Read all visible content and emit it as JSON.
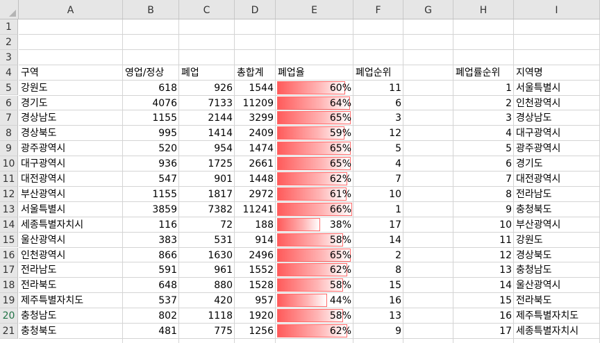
{
  "columns": [
    "A",
    "B",
    "C",
    "D",
    "E",
    "F",
    "G",
    "H",
    "I"
  ],
  "rows": [
    "1",
    "2",
    "3",
    "4",
    "5",
    "6",
    "7",
    "8",
    "9",
    "10",
    "11",
    "12",
    "13",
    "14",
    "15",
    "16",
    "17",
    "18",
    "19",
    "20",
    "21"
  ],
  "headers": {
    "A": "구역",
    "B": "영업/정상",
    "C": "폐업",
    "D": "총합계",
    "E": "폐업율",
    "F": "폐업순위",
    "H": "폐업률순위",
    "I": "지역명"
  },
  "table": [
    {
      "A": "강원도",
      "B": "618",
      "C": "926",
      "D": "1544",
      "E": "60%",
      "pct": 60,
      "F": "11",
      "H": "1",
      "I": "서울특별시"
    },
    {
      "A": "경기도",
      "B": "4076",
      "C": "7133",
      "D": "11209",
      "E": "64%",
      "pct": 64,
      "F": "6",
      "H": "2",
      "I": "인천광역시"
    },
    {
      "A": "경상남도",
      "B": "1155",
      "C": "2144",
      "D": "3299",
      "E": "65%",
      "pct": 65,
      "F": "3",
      "H": "3",
      "I": "경상남도"
    },
    {
      "A": "경상북도",
      "B": "995",
      "C": "1414",
      "D": "2409",
      "E": "59%",
      "pct": 59,
      "F": "12",
      "H": "4",
      "I": "대구광역시"
    },
    {
      "A": "광주광역시",
      "B": "520",
      "C": "954",
      "D": "1474",
      "E": "65%",
      "pct": 65,
      "F": "5",
      "H": "5",
      "I": "광주광역시"
    },
    {
      "A": "대구광역시",
      "B": "936",
      "C": "1725",
      "D": "2661",
      "E": "65%",
      "pct": 65,
      "F": "4",
      "H": "6",
      "I": "경기도"
    },
    {
      "A": "대전광역시",
      "B": "547",
      "C": "901",
      "D": "1448",
      "E": "62%",
      "pct": 62,
      "F": "7",
      "H": "7",
      "I": "대전광역시"
    },
    {
      "A": "부산광역시",
      "B": "1155",
      "C": "1817",
      "D": "2972",
      "E": "61%",
      "pct": 61,
      "F": "10",
      "H": "8",
      "I": "전라남도"
    },
    {
      "A": "서울특별시",
      "B": "3859",
      "C": "7382",
      "D": "11241",
      "E": "66%",
      "pct": 66,
      "F": "1",
      "H": "9",
      "I": "충청북도"
    },
    {
      "A": "세종특별자치시",
      "B": "116",
      "C": "72",
      "D": "188",
      "E": "38%",
      "pct": 38,
      "F": "17",
      "H": "10",
      "I": "부산광역시"
    },
    {
      "A": "울산광역시",
      "B": "383",
      "C": "531",
      "D": "914",
      "E": "58%",
      "pct": 58,
      "F": "14",
      "H": "11",
      "I": "강원도"
    },
    {
      "A": "인천광역시",
      "B": "866",
      "C": "1630",
      "D": "2496",
      "E": "65%",
      "pct": 65,
      "F": "2",
      "H": "12",
      "I": "경상북도"
    },
    {
      "A": "전라남도",
      "B": "591",
      "C": "961",
      "D": "1552",
      "E": "62%",
      "pct": 62,
      "F": "8",
      "H": "13",
      "I": "충청남도"
    },
    {
      "A": "전라북도",
      "B": "648",
      "C": "880",
      "D": "1528",
      "E": "58%",
      "pct": 58,
      "F": "15",
      "H": "14",
      "I": "울산광역시"
    },
    {
      "A": "제주특별자치도",
      "B": "537",
      "C": "420",
      "D": "957",
      "E": "44%",
      "pct": 44,
      "F": "16",
      "H": "15",
      "I": "전라북도"
    },
    {
      "A": "충청남도",
      "B": "802",
      "C": "1118",
      "D": "1920",
      "E": "58%",
      "pct": 58,
      "F": "13",
      "H": "16",
      "I": "제주특별자치도"
    },
    {
      "A": "충청북도",
      "B": "481",
      "C": "775",
      "D": "1256",
      "E": "62%",
      "pct": 62,
      "F": "9",
      "H": "17",
      "I": "세종특별자치시"
    }
  ],
  "colors": {
    "databar": "#ff5b5b",
    "header_bg": "#e6e6e6",
    "selected_row_header": "#217346"
  }
}
